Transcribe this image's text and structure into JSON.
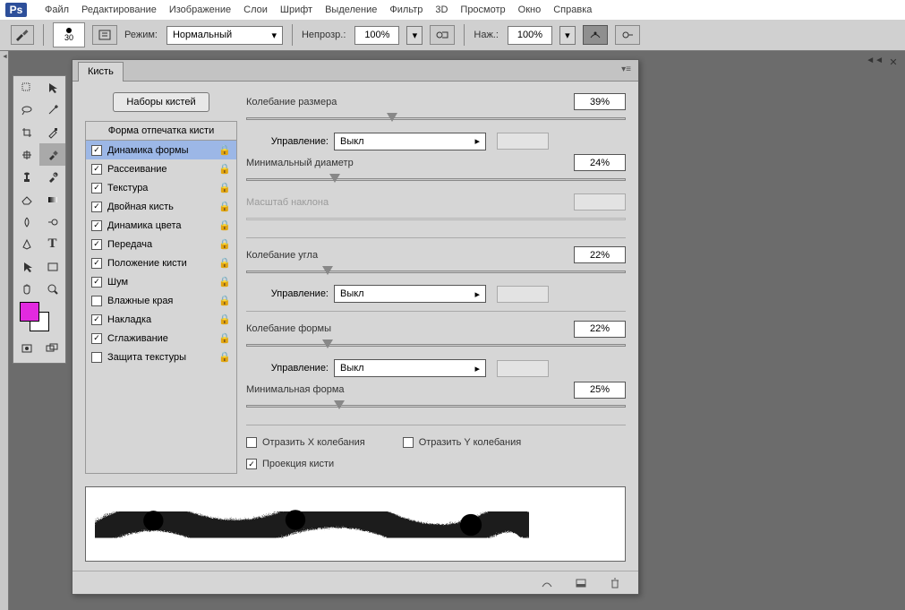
{
  "app": {
    "logo": "Ps"
  },
  "menu": {
    "items": [
      "Файл",
      "Редактирование",
      "Изображение",
      "Слои",
      "Шрифт",
      "Выделение",
      "Фильтр",
      "3D",
      "Просмотр",
      "Окно",
      "Справка"
    ]
  },
  "optbar": {
    "brush_size": "30",
    "mode_label": "Режим:",
    "mode_value": "Нормальный",
    "opacity_label": "Непрозр.:",
    "opacity_value": "100%",
    "flow_label": "Наж.:",
    "flow_value": "100%"
  },
  "panel": {
    "title": "Кисть",
    "presets_btn": "Наборы кистей",
    "tip_header": "Форма отпечатка кисти",
    "attrs": {
      "a0": "Динамика формы",
      "a1": "Рассеивание",
      "a2": "Текстура",
      "a3": "Двойная кисть",
      "a4": "Динамика цвета",
      "a5": "Передача",
      "a6": "Положение кисти",
      "a7": "Шум",
      "a8": "Влажные края",
      "a9": "Накладка",
      "a10": "Сглаживание",
      "a11": "Защита текстуры"
    }
  },
  "controls": {
    "size_jitter_label": "Колебание размера",
    "size_jitter_value": "39%",
    "control_label": "Управление:",
    "control1_value": "Выкл",
    "min_diam_label": "Минимальный диаметр",
    "min_diam_value": "24%",
    "tilt_scale_label": "Масштаб наклона",
    "angle_jitter_label": "Колебание угла",
    "angle_jitter_value": "22%",
    "control2_value": "Выкл",
    "round_jitter_label": "Колебание формы",
    "round_jitter_value": "22%",
    "control3_value": "Выкл",
    "min_round_label": "Минимальная форма",
    "min_round_value": "25%",
    "flipx_label": "Отразить X колебания",
    "flipy_label": "Отразить Y колебания",
    "proj_label": "Проекция кисти"
  }
}
